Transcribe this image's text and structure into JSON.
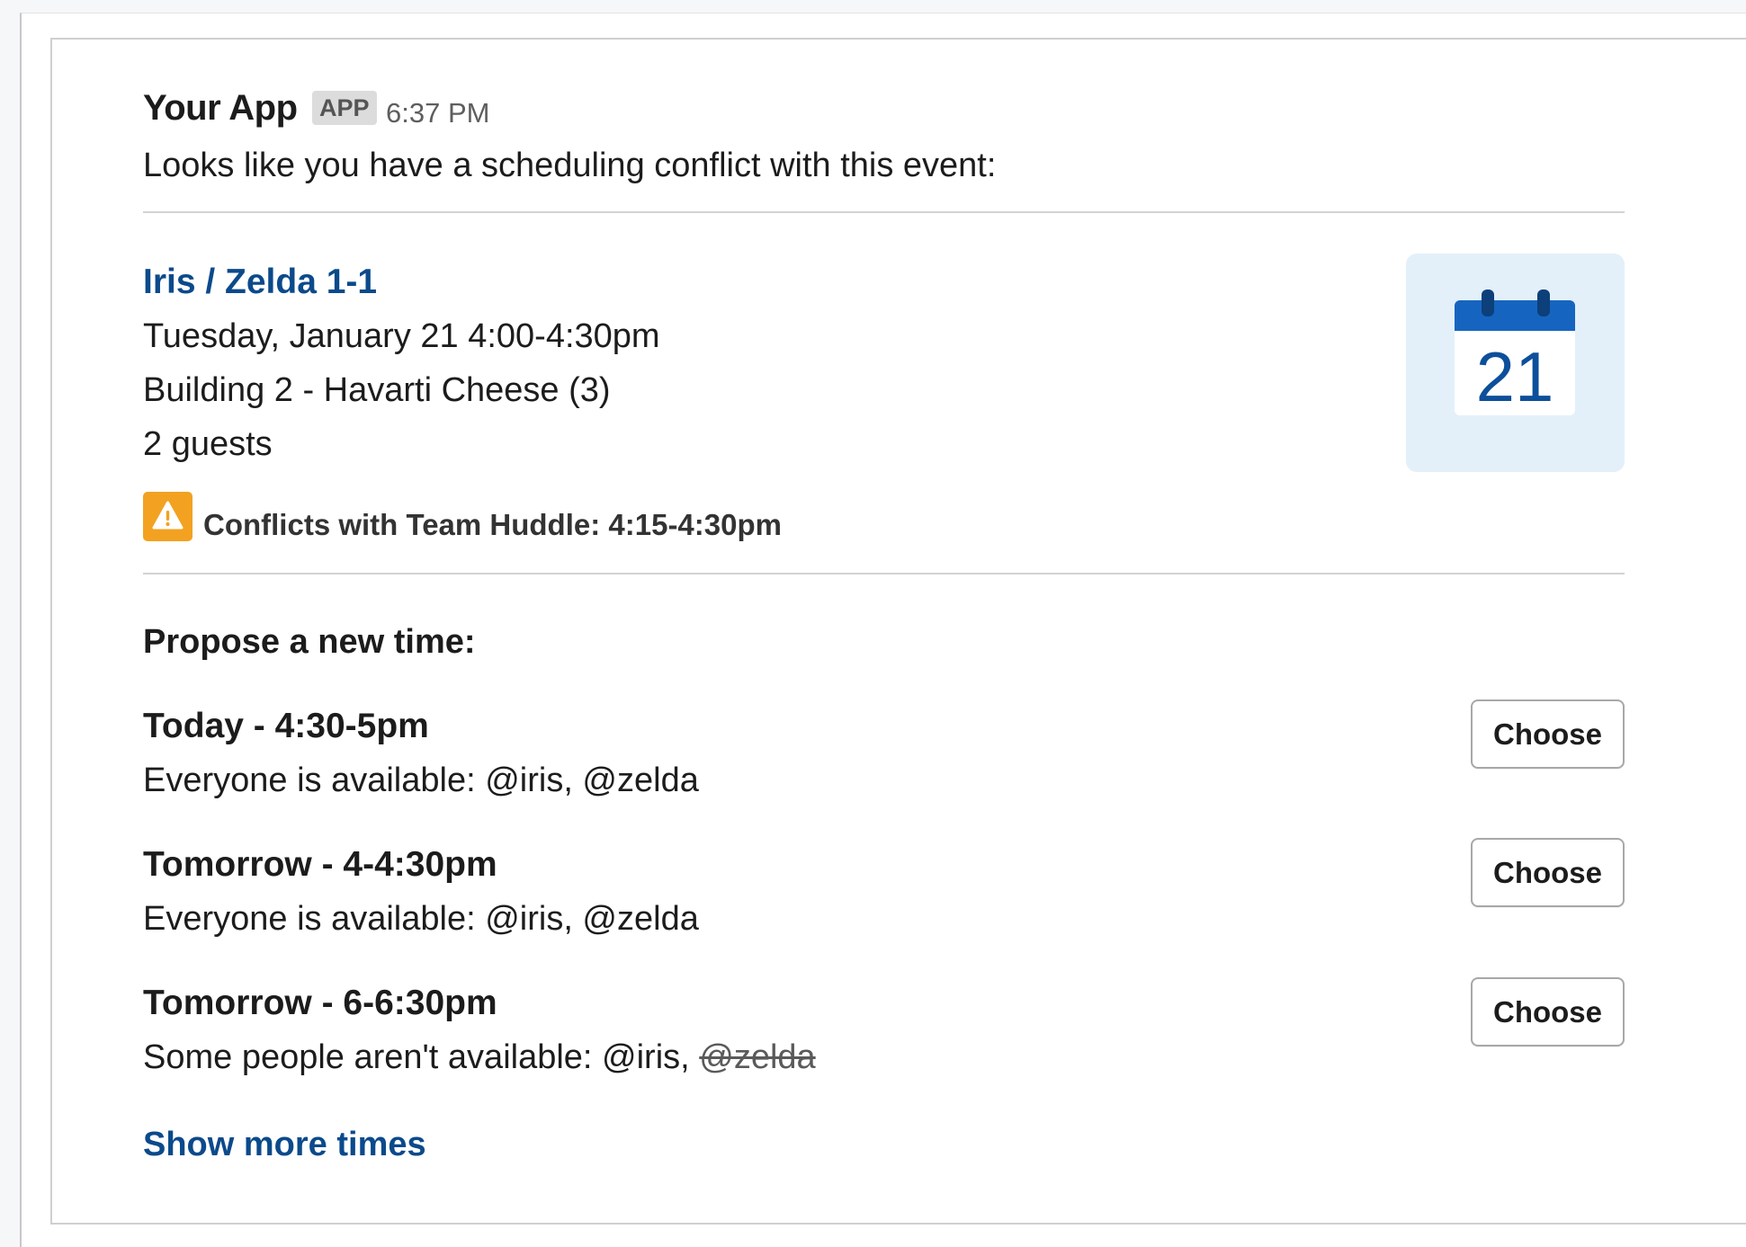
{
  "header": {
    "app_name": "Your App",
    "badge": "APP",
    "time": "6:37 PM"
  },
  "message": {
    "intro": "Looks like you have a scheduling conflict with this event:"
  },
  "event": {
    "title": "Iris / Zelda 1-1",
    "datetime": "Tuesday, January 21 4:00-4:30pm",
    "location": "Building 2 - Havarti Cheese (3)",
    "guests": "2 guests",
    "calendar_day": "21",
    "conflict": "Conflicts with Team Huddle: 4:15-4:30pm"
  },
  "proposals": {
    "heading": "Propose a new time:",
    "options": [
      {
        "title": "Today - 4:30-5pm",
        "availability": "Everyone is available: @iris, @zelda",
        "button": "Choose"
      },
      {
        "title": "Tomorrow - 4-4:30pm",
        "availability": "Everyone is available: @iris, @zelda",
        "button": "Choose"
      },
      {
        "title": "Tomorrow - 6-6:30pm",
        "availability_prefix": "Some people aren't available: @iris, ",
        "availability_unavailable": "@zelda",
        "button": "Choose"
      }
    ],
    "show_more": "Show more times"
  },
  "colors": {
    "link": "#0b4a8b",
    "warning": "#f2a220",
    "calendar_tile": "#e3f0fa",
    "calendar_header": "#1565c0"
  },
  "icons": {
    "warning": "warning-triangle-icon",
    "calendar": "calendar-icon"
  }
}
